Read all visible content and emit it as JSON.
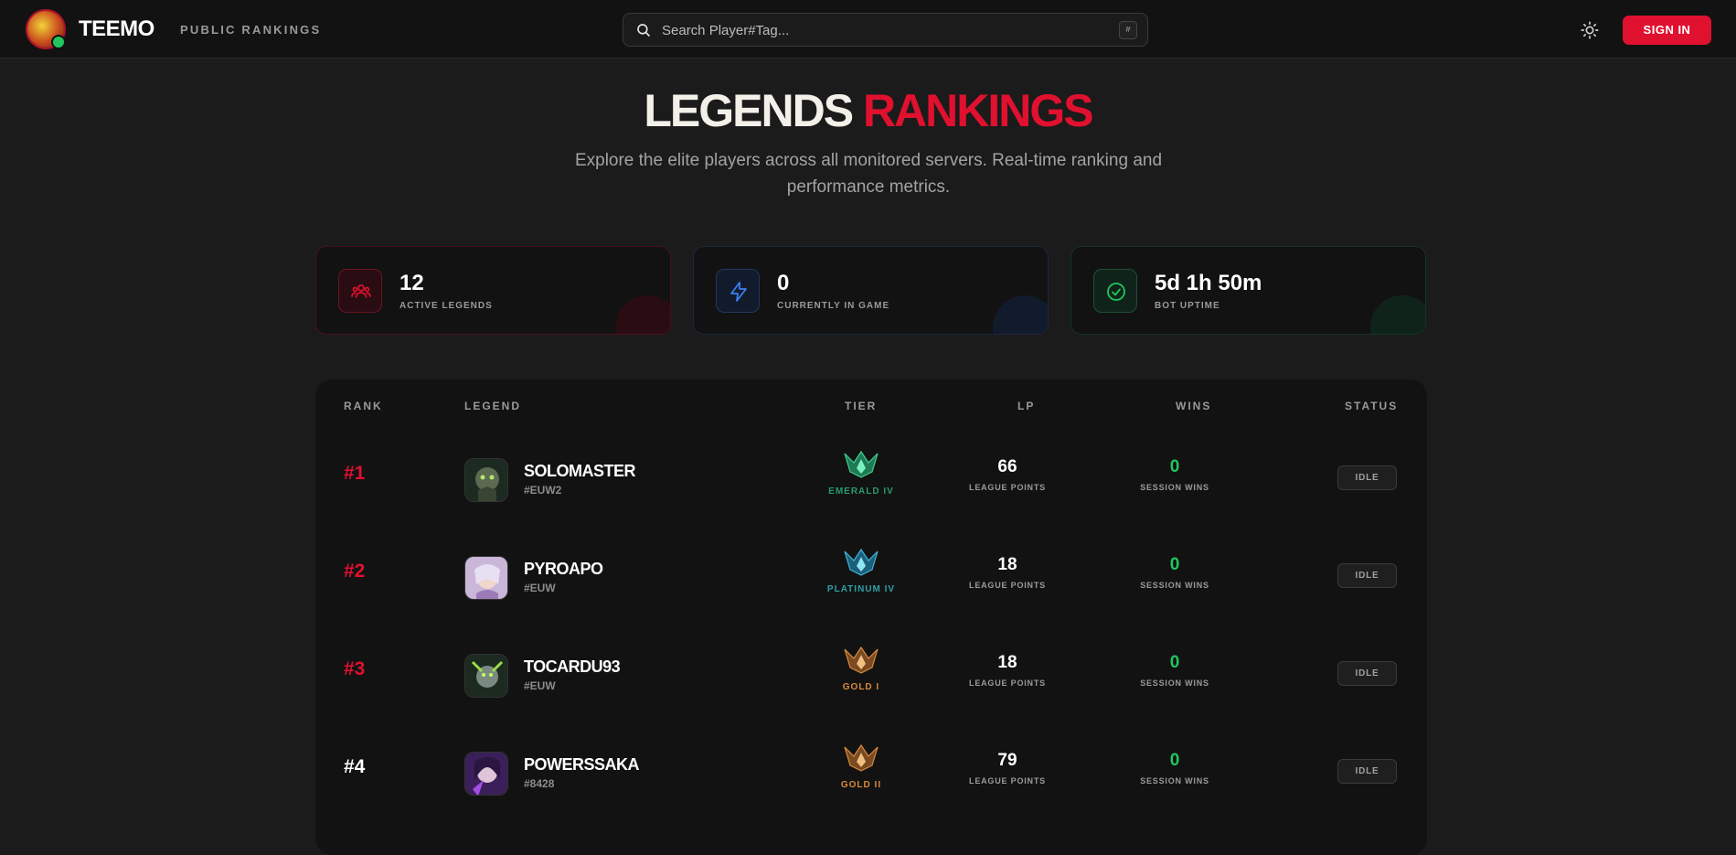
{
  "header": {
    "brand": "TEEMO",
    "nav_link": "PUBLIC RANKINGS",
    "search_placeholder": "Search Player#Tag...",
    "search_shortcut": "#",
    "sign_in": "SIGN IN",
    "icons": {
      "logo": "teemo-avatar",
      "search": "search-icon",
      "theme": "sun-icon"
    }
  },
  "hero": {
    "title_white": "LEGENDS",
    "title_red": "RANKINGS",
    "subtitle": "Explore the elite players across all monitored servers. Real-time ranking and performance metrics."
  },
  "stats": [
    {
      "value": "12",
      "label": "ACTIVE LEGENDS",
      "icon": "users-icon",
      "color": "#e0102f"
    },
    {
      "value": "0",
      "label": "CURRENTLY IN GAME",
      "icon": "lightning-icon",
      "color": "#3b82f6"
    },
    {
      "value": "5d 1h 50m",
      "label": "BOT UPTIME",
      "icon": "check-circle-icon",
      "color": "#22c55e"
    }
  ],
  "table": {
    "headers": {
      "rank": "RANK",
      "legend": "LEGEND",
      "tier": "TIER",
      "lp": "LP",
      "wins": "WINS",
      "status": "STATUS"
    },
    "rows": [
      {
        "rank": "#1",
        "name": "SOLOMASTER",
        "tag": "#EUW2",
        "tier": "EMERALD IV",
        "tier_color": "#2a9a6a",
        "lp": "66",
        "lp_label": "LEAGUE POINTS",
        "wins": "0",
        "wins_label": "SESSION WINS",
        "status": "IDLE"
      },
      {
        "rank": "#2",
        "name": "PYROAPO",
        "tag": "#EUW",
        "tier": "PLATINUM IV",
        "tier_color": "#2f9fa8",
        "lp": "18",
        "lp_label": "LEAGUE POINTS",
        "wins": "0",
        "wins_label": "SESSION WINS",
        "status": "IDLE"
      },
      {
        "rank": "#3",
        "name": "TOCARDU93",
        "tag": "#EUW",
        "tier": "GOLD I",
        "tier_color": "#d98a3a",
        "lp": "18",
        "lp_label": "LEAGUE POINTS",
        "wins": "0",
        "wins_label": "SESSION WINS",
        "status": "IDLE"
      },
      {
        "rank": "#4",
        "name": "POWERSSAKA",
        "tag": "#8428",
        "tier": "GOLD II",
        "tier_color": "#d98a3a",
        "lp": "79",
        "lp_label": "LEAGUE POINTS",
        "wins": "0",
        "wins_label": "SESSION WINS",
        "status": "IDLE"
      }
    ]
  }
}
